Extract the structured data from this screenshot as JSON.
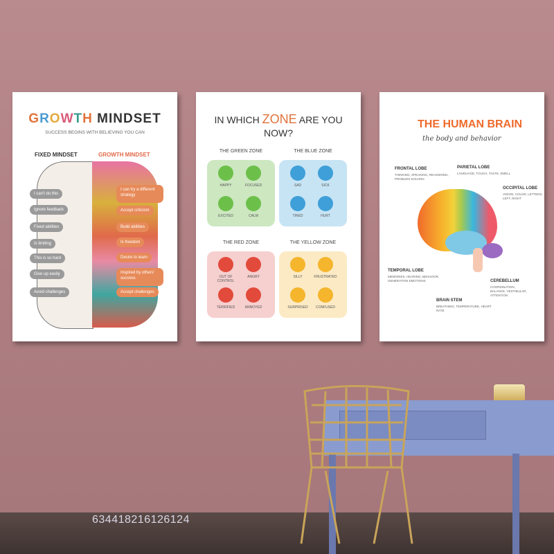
{
  "poster_growth": {
    "title_letters": [
      {
        "ch": "G",
        "color": "#e0733b"
      },
      {
        "ch": "R",
        "color": "#4a9bd1"
      },
      {
        "ch": "O",
        "color": "#e5a93a"
      },
      {
        "ch": "W",
        "color": "#d95a7b"
      },
      {
        "ch": "T",
        "color": "#3a9a8f"
      },
      {
        "ch": "H",
        "color": "#e0733b"
      },
      {
        "ch": " ",
        "color": "#000"
      },
      {
        "ch": "M",
        "color": "#333"
      },
      {
        "ch": "I",
        "color": "#333"
      },
      {
        "ch": "N",
        "color": "#333"
      },
      {
        "ch": "D",
        "color": "#333"
      },
      {
        "ch": "S",
        "color": "#333"
      },
      {
        "ch": "E",
        "color": "#333"
      },
      {
        "ch": "T",
        "color": "#333"
      }
    ],
    "subtitle": "SUCCESS BEGINS WITH BELIEVING YOU CAN",
    "fixed_header": "FIXED MINDSET",
    "growth_header": "GROWTH MINDSET",
    "fixed_items": [
      "I can't do this",
      "Ignore feedback",
      "Fixed abilities",
      "Is limiting",
      "This is so hard",
      "Give up easily",
      "Avoid challenges"
    ],
    "growth_items": [
      "I can try a different strategy",
      "Accept criticism",
      "Build abilities",
      "Is freedom",
      "Desire to learn",
      "Inspired by others' success",
      "Accept challenges"
    ]
  },
  "poster_zones": {
    "title_line1_a": "IN WHICH ",
    "title_line1_b": "ZONE",
    "title_line1_c": " ARE YOU",
    "title_line2": "NOW?",
    "zones": [
      {
        "name": "THE GREEN ZONE",
        "bg": "#cde7c1",
        "face": "#6cc04a",
        "labels": [
          "HAPPY",
          "FOCUSED",
          "EXCITED",
          "CALM"
        ]
      },
      {
        "name": "THE BLUE ZONE",
        "bg": "#c7e4f4",
        "face": "#3f9fd8",
        "labels": [
          "SAD",
          "SICK",
          "TIRED",
          "HURT"
        ]
      },
      {
        "name": "THE RED ZONE",
        "bg": "#f6cfcf",
        "face": "#e24a3b",
        "labels": [
          "OUT OF CONTROL",
          "ANGRY",
          "TERRIFIED",
          "ANNOYED"
        ]
      },
      {
        "name": "THE YELLOW ZONE",
        "bg": "#fbeac4",
        "face": "#f5b52c",
        "labels": [
          "SILLY",
          "FRUSTRATED",
          "SURPRISED",
          "CONFUSED"
        ]
      }
    ]
  },
  "poster_brain": {
    "title": "THE HUMAN BRAIN",
    "subtitle": "the body and behavior",
    "lobes": [
      {
        "name": "FRONTAL LOBE",
        "text": "THINKING, SPEAKING, REASONING, PROBLEM SOLVING"
      },
      {
        "name": "PARIETAL LOBE",
        "text": "LANGUAGE, TOUCH, TASTE, SMELL"
      },
      {
        "name": "OCCIPITAL LOBE",
        "text": "VISION, COLOR, LETTERS, LEFT, RIGHT"
      },
      {
        "name": "TEMPORAL LOBE",
        "text": "MEMORIES, HEARING, BEHAVIOR, GENERATION EMOTIONS"
      },
      {
        "name": "CEREBELLUM",
        "text": "COORDINATION, BALANCE, VESTIBULAR, ATTENTION"
      },
      {
        "name": "BRAIN STEM",
        "text": "BREATHING, TEMPERATURE, HEART RATE"
      }
    ]
  },
  "watermark": "634418216126124"
}
